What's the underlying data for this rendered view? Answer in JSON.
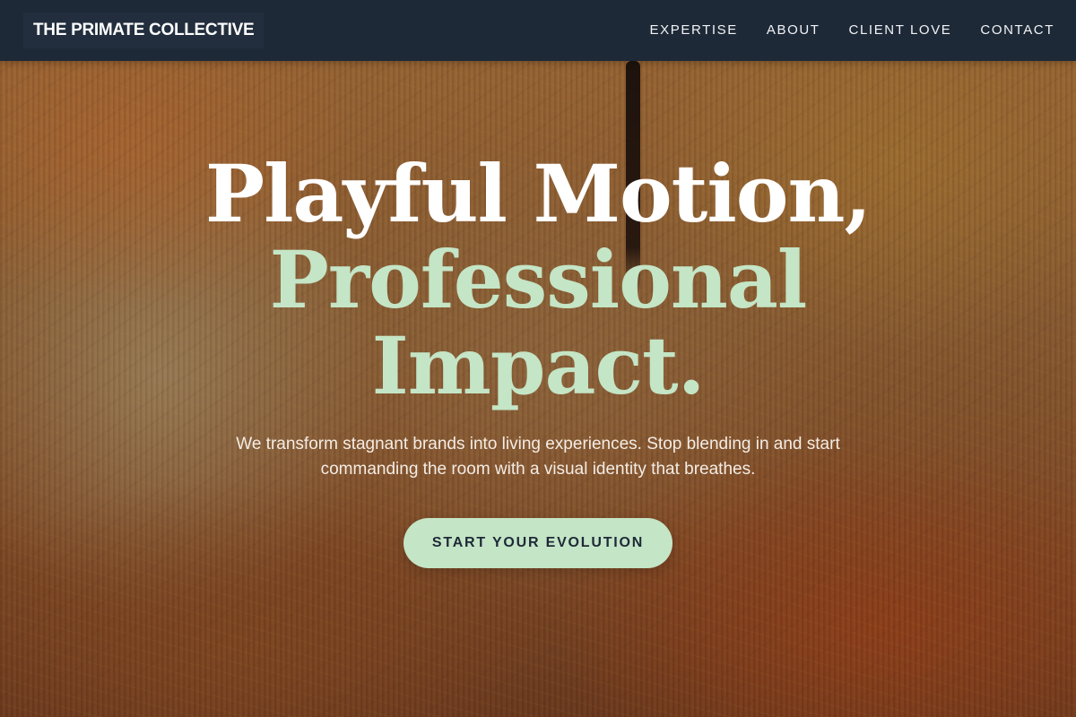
{
  "brand": {
    "name": "THE PRIMATE COLLECTIVE"
  },
  "nav": {
    "links": [
      {
        "label": "EXPERTISE"
      },
      {
        "label": "ABOUT"
      },
      {
        "label": "CLIENT LOVE"
      },
      {
        "label": "CONTACT"
      }
    ]
  },
  "hero": {
    "headline_line1": "Playful Motion,",
    "headline_line2": "Professional",
    "headline_line3": "Impact.",
    "subtitle": "We transform stagnant brands into living experiences. Stop blending in and start commanding the room with a visual identity that breathes.",
    "cta_label": "START YOUR EVOLUTION"
  },
  "colors": {
    "nav_background": "#1e2937",
    "accent_mint": "#c4e5c6",
    "headline_white": "#ffffff",
    "background_tone": "#a06a38"
  }
}
